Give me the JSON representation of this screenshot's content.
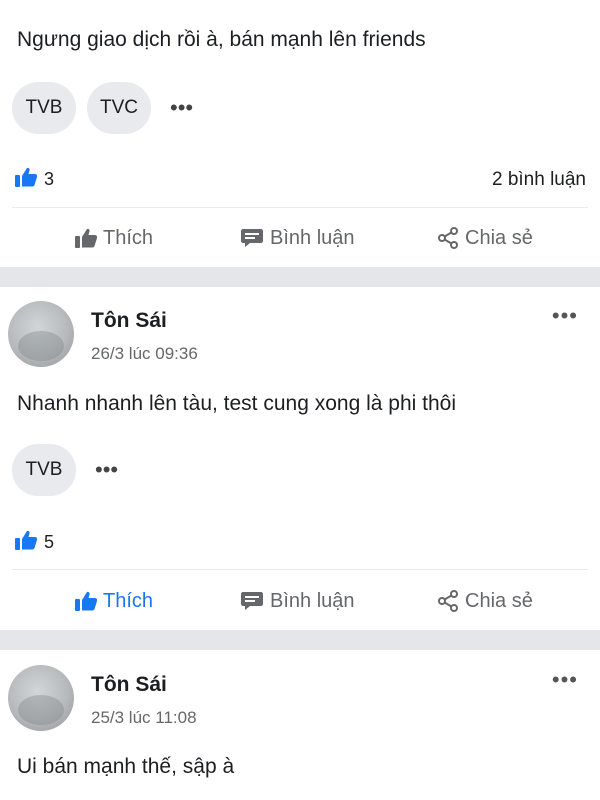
{
  "colors": {
    "accent": "#1877f2",
    "secondary_text": "#65676b",
    "separator": "#e4e6e9",
    "tag_bg": "#e9eaed"
  },
  "posts": [
    {
      "text": "Ngưng giao dịch rồi à, bán mạnh lên friends",
      "tags": [
        "TVB",
        "TVC"
      ],
      "likes": "3",
      "comments": "2 bình luận",
      "liked": false
    },
    {
      "author": "Tôn Sái",
      "timestamp": "26/3 lúc 09:36",
      "text": "Nhanh nhanh lên tàu, test cung xong là phi thôi",
      "tags": [
        "TVB"
      ],
      "likes": "5",
      "liked": true
    },
    {
      "author": "Tôn Sái",
      "timestamp": "25/3 lúc 11:08",
      "text": "Ui bán mạnh thế, sập à"
    }
  ],
  "actions": {
    "like": "Thích",
    "comment": "Bình luận",
    "share": "Chia sẻ"
  },
  "icons": {
    "like": "thumbs-up-icon",
    "comment": "comment-bubble-icon",
    "share": "share-icon",
    "more": "ellipsis-icon",
    "more_glyph": "•••"
  }
}
